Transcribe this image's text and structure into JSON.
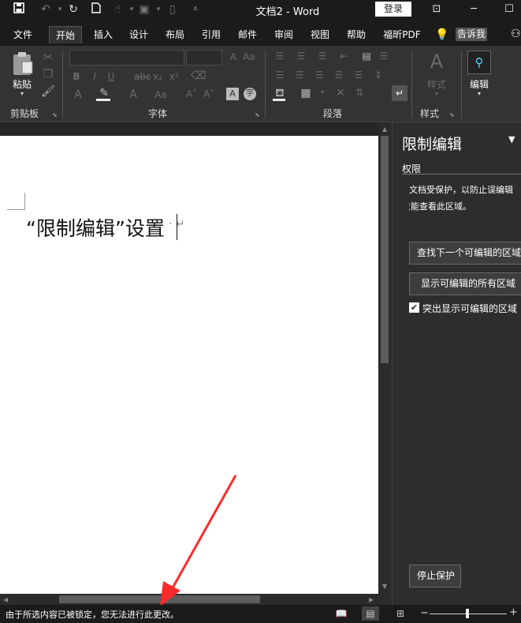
{
  "titlebar": {
    "title": "文档2  -  Word",
    "login_label": "登录"
  },
  "tabs": [
    "文件",
    "开始",
    "插入",
    "设计",
    "布局",
    "引用",
    "邮件",
    "审阅",
    "视图",
    "帮助",
    "福昕PDF"
  ],
  "tell_me": "告诉我",
  "ribbon": {
    "paste_label": "粘贴",
    "groups": {
      "clipboard": "剪贴板",
      "font": "字体",
      "paragraph": "段落",
      "styles": "样式"
    },
    "styles_label": "样式",
    "editing_label": "编辑"
  },
  "document": {
    "text": "“限制编辑”设置"
  },
  "pane": {
    "title": "限制编辑",
    "section": "权限",
    "desc_line1": "文档受保护，以防止误编辑",
    "desc_line2": "只能查看此区域。",
    "find_next_label": "查找下一个可编辑的区域",
    "show_all_label": "显示可编辑的所有区域",
    "highlight_label": "突出显示可编辑的区域",
    "highlight_checked": true,
    "stop_label": "停止保护"
  },
  "status": {
    "message": "由于所选内容已被锁定，您无法进行此更改。"
  },
  "icons": {
    "save": "save-icon",
    "undo": "undo-icon",
    "redo": "redo-icon",
    "new": "new-doc-icon",
    "editing": "find-icon"
  },
  "colors": {
    "accent_arrow": "#ff2a2a",
    "ribbon_bg": "#333333"
  }
}
